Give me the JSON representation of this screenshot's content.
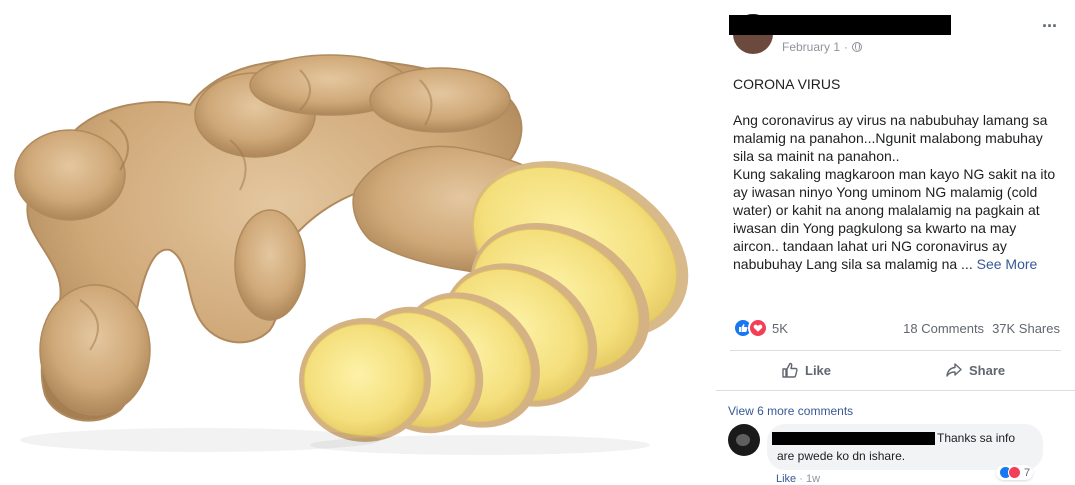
{
  "post": {
    "date": "February 1",
    "separator": "·",
    "heading": "CORONA VIRUS",
    "body_lines": [
      "Ang coronavirus ay virus na nabubuhay lamang sa",
      "malamig na panahon...Ngunit malabong mabuhay",
      "sila sa mainit na panahon..",
      "Kung sakaling magkaroon man kayo NG sakit na ito",
      "ay iwasan ninyo Yong uminom NG malamig (cold",
      "water) or kahit na anong malalamig na pagkain at",
      "iwasan din Yong pagkulong sa kwarto na may",
      "aircon.. tandaan lahat uri NG coronavirus ay"
    ],
    "last_line": "nabubuhay Lang sila sa malamig na ... ",
    "see_more": "See More"
  },
  "stats": {
    "reactions": "5K",
    "comments": "18 Comments",
    "shares": "37K Shares"
  },
  "actions": {
    "like": "Like",
    "share": "Share"
  },
  "comments": {
    "view_more": "View 6 more comments",
    "items": [
      {
        "text_line1": "Thanks sa info",
        "text_line2": "are pwede ko dn ishare.",
        "reaction_count": "7",
        "like_label": "Like",
        "time": "· 1w"
      }
    ]
  },
  "icons": {
    "menu": "more-horizontal-icon",
    "privacy": "globe-icon",
    "like": "thumbs-up-icon",
    "share": "share-arrow-icon"
  },
  "colors": {
    "link": "#385898",
    "like_blue": "#1877f2",
    "love_red": "#f33e58"
  }
}
